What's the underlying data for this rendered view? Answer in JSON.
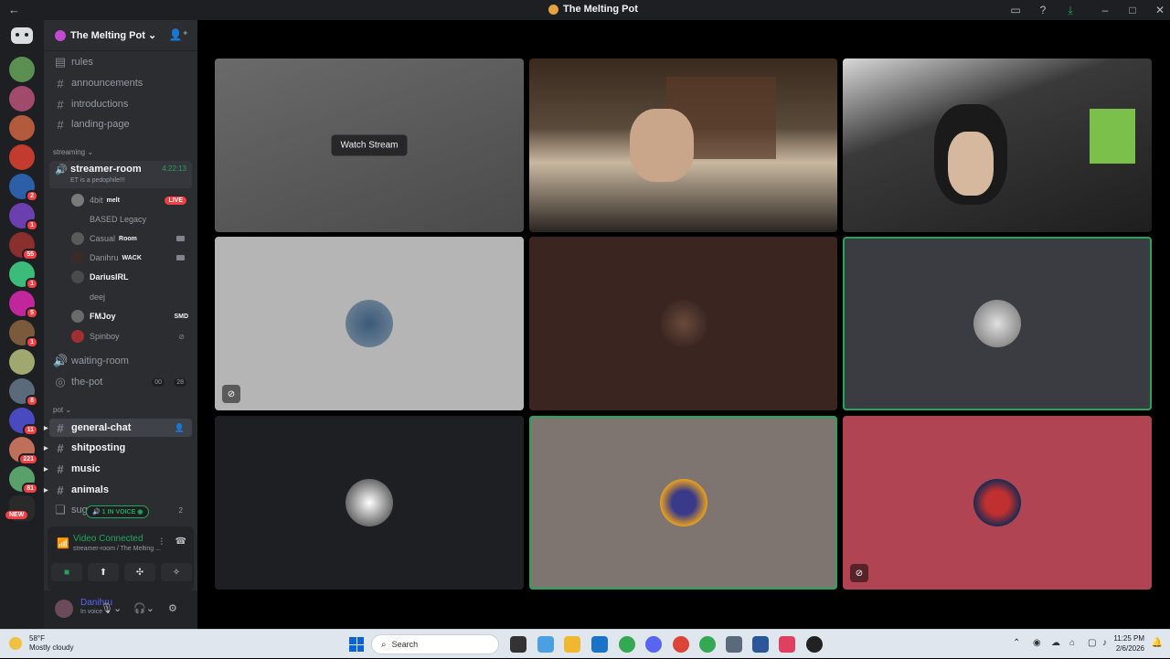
{
  "window": {
    "title": "The Melting Pot"
  },
  "server": {
    "name": "The Melting Pot"
  },
  "channels_top": [
    {
      "name": "rules"
    },
    {
      "name": "announcements"
    },
    {
      "name": "introductions"
    },
    {
      "name": "landing-page"
    }
  ],
  "category_streaming": "streaming",
  "streamer_room": {
    "name": "streamer-room",
    "time": "4:22:13",
    "status": "ET is a pedophile!!!"
  },
  "voice_users": [
    {
      "name": "4bit",
      "tag": "melt",
      "live": "LIVE"
    },
    {
      "name": "BASED Legacy"
    },
    {
      "name": "Casual",
      "tag": "Room"
    },
    {
      "name": "Danihru",
      "tag": "WACK"
    },
    {
      "name": "DariusIRL"
    },
    {
      "name": "deej"
    },
    {
      "name": "FMJoy",
      "tag": "SMD"
    },
    {
      "name": "Spinboy"
    }
  ],
  "waiting_room": "waiting-room",
  "the_pot": {
    "name": "the-pot",
    "count_a": "00",
    "count_b": "28"
  },
  "category_pot": "pot",
  "channels_pot": [
    {
      "name": "general-chat"
    },
    {
      "name": "shitposting"
    },
    {
      "name": "music"
    },
    {
      "name": "animals"
    },
    {
      "name": "sugg"
    }
  ],
  "in_voice_pill": "1 IN VOICE",
  "sugg_count": "2",
  "rail_badges": [
    "2",
    "1",
    "1",
    "55",
    "1",
    "5",
    "8",
    "1",
    "8",
    "11",
    "221",
    "81"
  ],
  "rail_new": "NEW",
  "voice_panel": {
    "title": "Video Connected",
    "subtitle": "streamer-room / The Melting ..."
  },
  "user_panel": {
    "name": "Danihru",
    "status": "In voice"
  },
  "stage": {
    "watch_stream": "Watch Stream"
  },
  "taskbar": {
    "temp": "58°F",
    "weather": "Mostly cloudy",
    "search": "Search",
    "time": "11:25 PM",
    "date": "2/6/2026"
  },
  "colors": {
    "accent_green": "#23a55a",
    "danger_red": "#f23f43",
    "blurple": "#5865f2"
  },
  "icons": {
    "back": "arrow-left-icon",
    "inbox": "inbox-icon",
    "help": "help-icon",
    "download": "download-icon",
    "minimize": "minimize-icon",
    "maximize": "maximize-icon",
    "close": "close-icon"
  }
}
